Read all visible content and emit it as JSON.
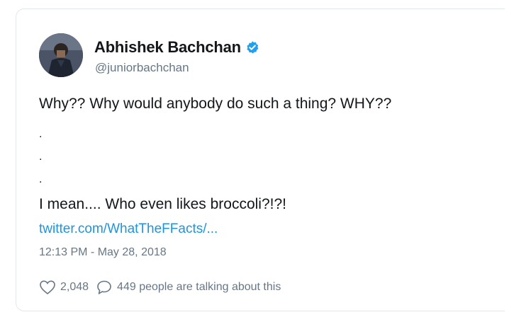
{
  "tweet": {
    "author": {
      "name": "Abhishek Bachchan",
      "handle": "@juniorbachchan",
      "verified_icon": "verified-badge-icon",
      "avatar_icon": "profile-photo"
    },
    "text_lines": [
      "Why?? Why would anybody do such a thing? WHY??",
      ".",
      ".",
      ".",
      "I mean.... Who even likes broccoli?!?!"
    ],
    "link": "twitter.com/WhatTheFFacts/...",
    "timestamp": "12:13 PM - May 28, 2018",
    "likes": "2,048",
    "replies_text": "449 people are talking about this",
    "colors": {
      "name": "#14171a",
      "secondary": "#657786",
      "link": "#1b95e0",
      "verified": "#1da1f2",
      "border": "#e1e8ed"
    }
  }
}
